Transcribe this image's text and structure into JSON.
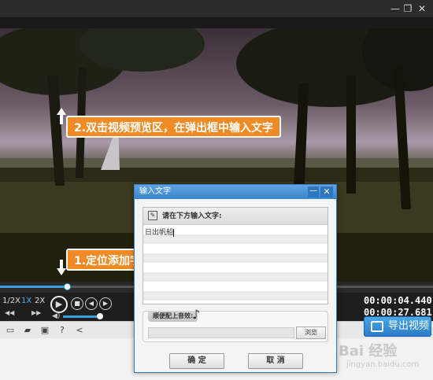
{
  "window": {
    "min_label": "—",
    "restore_label": "❐",
    "close_label": "✕"
  },
  "callouts": {
    "step2": "2.双击视频预览区，在弹出框中输入文字",
    "step1": "1.定位添加字幕的时间点"
  },
  "timeline": {
    "progress": 0.155
  },
  "controls": {
    "speeds": [
      "1/2X",
      "1X",
      "2X"
    ],
    "active_speed": "1X",
    "play_icon": "play-icon",
    "current_time": "00:00:04.440",
    "total_time": "00:00:27.681",
    "volume_level": 0.9
  },
  "bottombar": {
    "export_label": "导出视频",
    "icons": [
      "subtitle-icon",
      "folder-icon",
      "save-icon",
      "help-icon",
      "share-icon"
    ]
  },
  "dialog": {
    "title": "输入文字",
    "min_label": "—",
    "close_label": "✕",
    "prompt_label": "请在下方输入文字:",
    "text_value": "日出帆船",
    "audio_label": "顺便配上音效:",
    "browse_label": "浏览",
    "ok_label": "确 定",
    "cancel_label": "取 消"
  },
  "watermark": {
    "text": "Bai 经验",
    "sub": "jingyan.baidu.com"
  },
  "colors": {
    "accent": "#3aa0e0",
    "callout": "#f08a24",
    "titlebar": "#2b2b2b"
  }
}
